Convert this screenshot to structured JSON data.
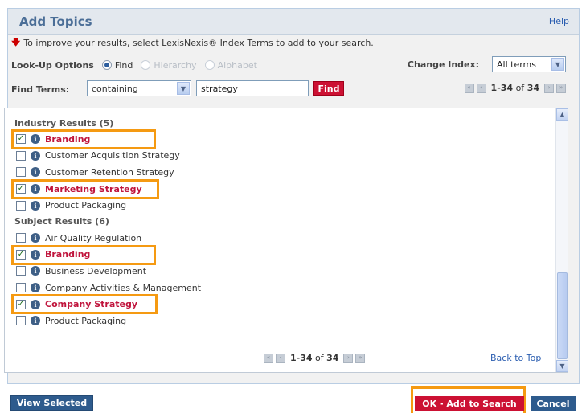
{
  "dialog": {
    "title": "Add Topics",
    "help_label": "Help",
    "info_text": "To improve your results, select LexisNexis® Index Terms to add to your search."
  },
  "lookup": {
    "label": "Look-Up Options",
    "options": [
      {
        "label": "Find",
        "selected": true,
        "enabled": true
      },
      {
        "label": "Hierarchy",
        "selected": false,
        "enabled": false
      },
      {
        "label": "Alphabet",
        "selected": false,
        "enabled": false
      }
    ],
    "change_index_label": "Change Index:",
    "index_value": "All terms"
  },
  "find": {
    "label": "Find Terms:",
    "mode_value": "containing",
    "query_value": "strategy",
    "button_label": "Find"
  },
  "pager": {
    "range": "1-34",
    "of_label": "of",
    "total": "34"
  },
  "results": {
    "groups": [
      {
        "heading": "Industry Results (5)",
        "items": [
          {
            "label": "Branding",
            "checked": true
          },
          {
            "label": "Customer Acquisition Strategy",
            "checked": false
          },
          {
            "label": "Customer Retention Strategy",
            "checked": false
          },
          {
            "label": "Marketing Strategy",
            "checked": true
          },
          {
            "label": "Product Packaging",
            "checked": false
          }
        ]
      },
      {
        "heading": "Subject Results (6)",
        "items": [
          {
            "label": "Air Quality Regulation",
            "checked": false
          },
          {
            "label": "Branding",
            "checked": true
          },
          {
            "label": "Business Development",
            "checked": false
          },
          {
            "label": "Company Activities & Management",
            "checked": false
          },
          {
            "label": "Company Strategy",
            "checked": true
          },
          {
            "label": "Product Packaging",
            "checked": false
          }
        ]
      }
    ],
    "back_to_top": "Back to Top"
  },
  "footer": {
    "view_selected": "View Selected",
    "ok_label": "OK - Add to Search",
    "cancel_label": "Cancel"
  },
  "colors": {
    "accent_red": "#cc1133",
    "highlight_orange": "#f59a12",
    "nav_blue": "#2e5b8d"
  }
}
